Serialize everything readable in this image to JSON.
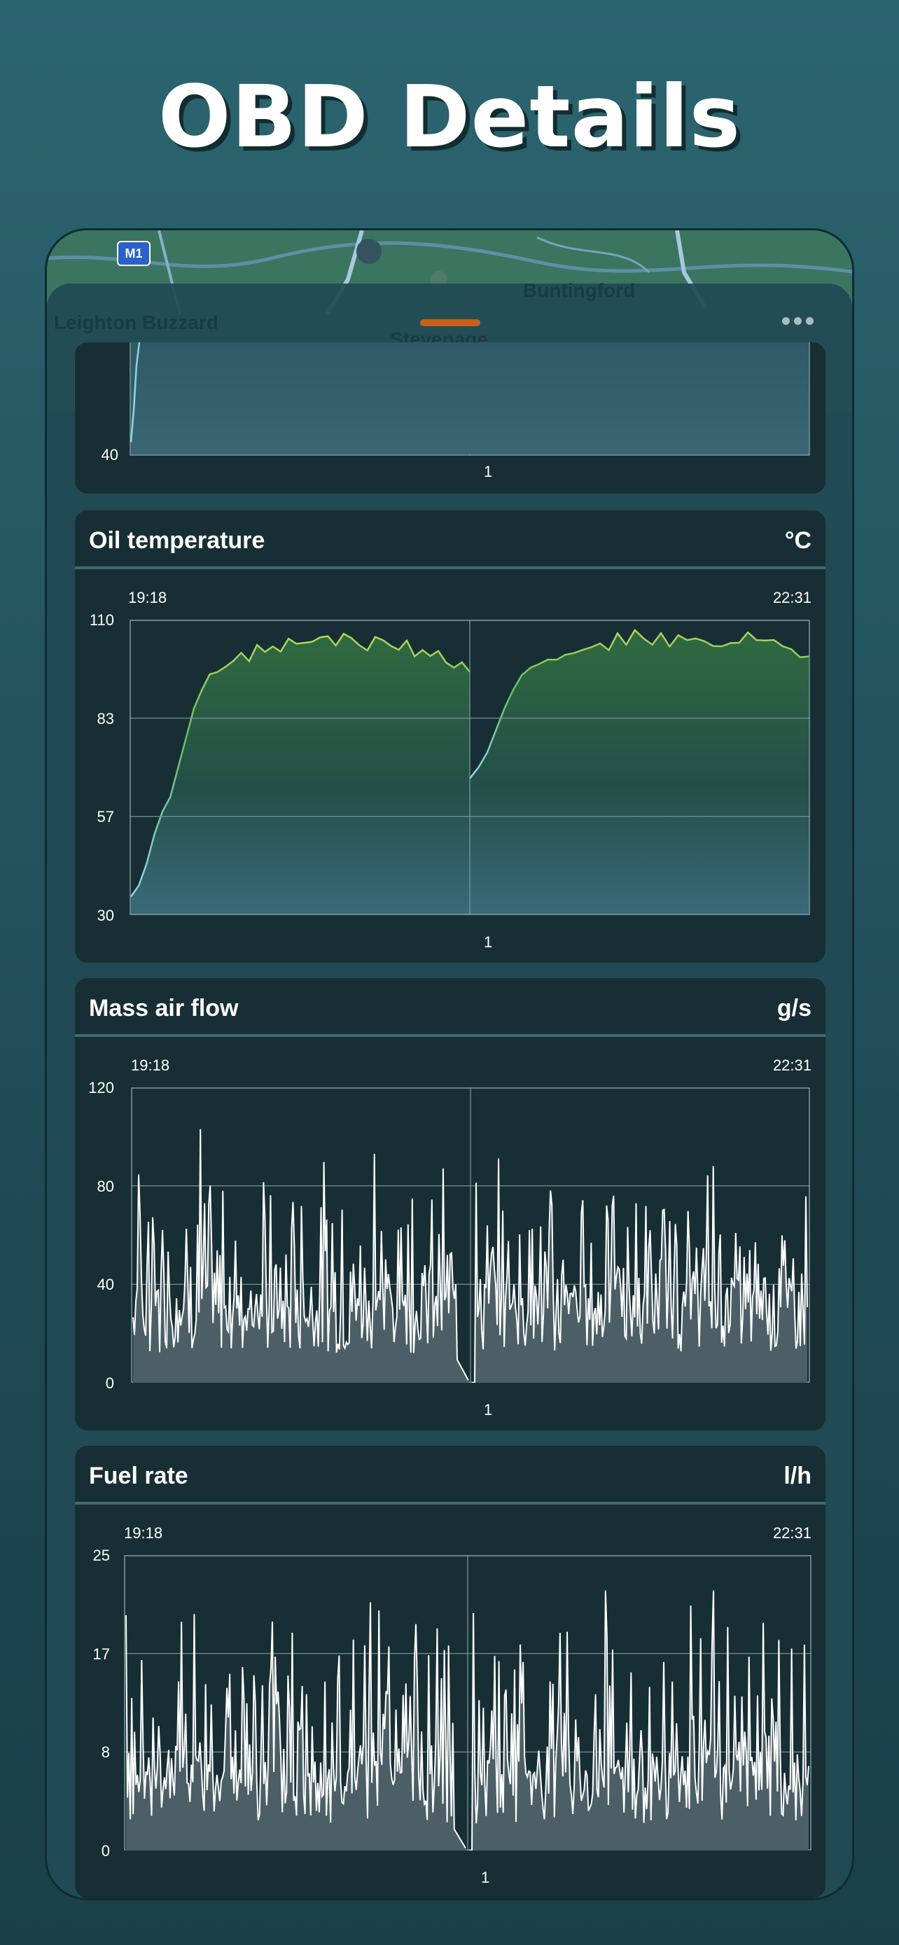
{
  "hero": {
    "title": "OBD Details"
  },
  "map": {
    "motorway": "M1",
    "places": [
      "Leighton Buzzard",
      "Stevenage",
      "Buntingford"
    ]
  },
  "sheet": {
    "menu_icon": "more-horizontal-icon",
    "handle_color": "#c8601a"
  },
  "colors": {
    "card_bg": "#182e35",
    "grid": "#7f9aa0",
    "temp_low": "#8fd3ea",
    "temp_high": "#b6d55a",
    "white_line": "#ffffff"
  },
  "cards": [
    {
      "title": "",
      "unit": "",
      "chart_data": {
        "type": "line",
        "title": "",
        "yticks": [
          "40"
        ],
        "xtick": "1",
        "ylim": [
          40,
          65
        ],
        "note": "partially scrolled off; only lower part visible",
        "series": [
          {
            "values": [
              43,
              50,
              60,
              66
            ]
          }
        ]
      }
    },
    {
      "title": "Oil temperature",
      "unit": "°C",
      "start_time": "19:18",
      "end_time": "22:31",
      "chart_data": {
        "type": "area",
        "yticks": [
          "110",
          "83",
          "57",
          "30"
        ],
        "ylim": [
          30,
          110
        ],
        "xtick": "1",
        "segments": [
          [
            35,
            38,
            44,
            52,
            58,
            62,
            70,
            78,
            86,
            91,
            95,
            97,
            98,
            99,
            101,
            100,
            102,
            101,
            103,
            102,
            104,
            103,
            105,
            104,
            106,
            105,
            104,
            106,
            105,
            104,
            103,
            104,
            103,
            104,
            102,
            103,
            101,
            102,
            100,
            101,
            99,
            98,
            97,
            96
          ],
          [
            67,
            70,
            74,
            80,
            86,
            91,
            95,
            97,
            98,
            100,
            99,
            101,
            102,
            101,
            103,
            104,
            103,
            105,
            104,
            106,
            105,
            104,
            106,
            103,
            105,
            104,
            106,
            105,
            103,
            104,
            105,
            104,
            106,
            104,
            103,
            105,
            103,
            102,
            100,
            99
          ]
        ]
      }
    },
    {
      "title": "Mass air flow",
      "unit": "g/s",
      "start_time": "19:18",
      "end_time": "22:31",
      "chart_data": {
        "type": "line",
        "yticks": [
          "120",
          "80",
          "40",
          "0"
        ],
        "ylim": [
          0,
          120
        ],
        "xtick": "1",
        "peaks": [
          93,
          103,
          88,
          72
        ]
      }
    },
    {
      "title": "Fuel rate",
      "unit": "l/h",
      "start_time": "19:18",
      "end_time": "22:31",
      "chart_data": {
        "type": "line",
        "yticks": [
          "25",
          "17",
          "8",
          "0"
        ],
        "ylim": [
          0,
          25
        ],
        "xtick": "1",
        "peaks": [
          21,
          20,
          22,
          22
        ]
      }
    }
  ]
}
